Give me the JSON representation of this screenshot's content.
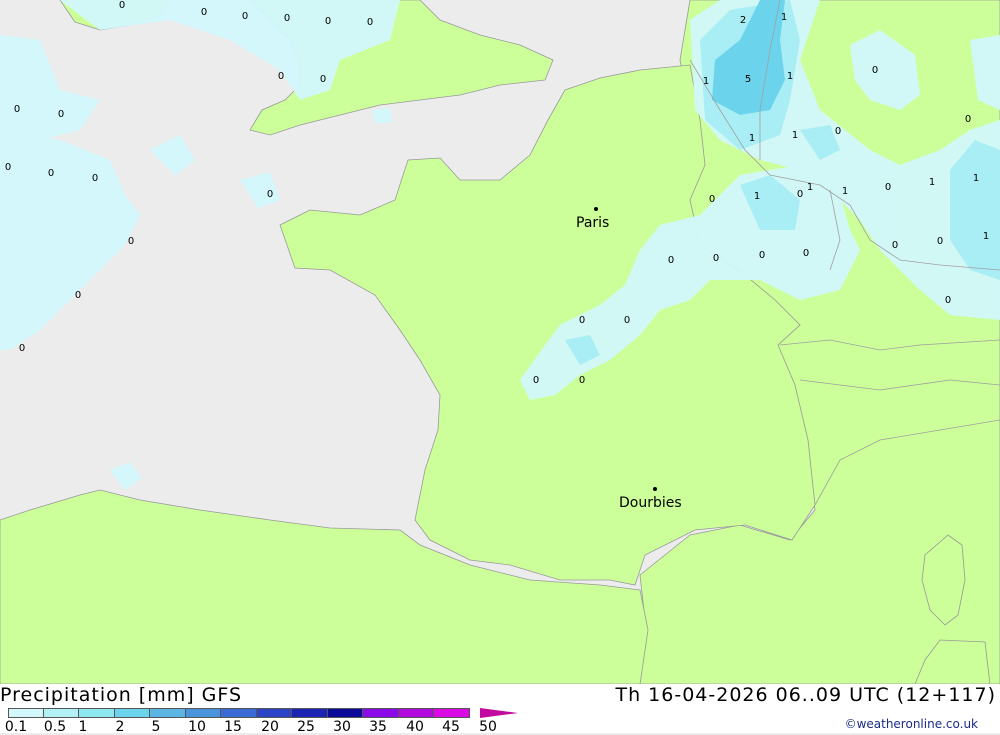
{
  "title": "Precipitation [mm] GFS",
  "valid_time": "Th 16-04-2026 06..09 UTC (12+117)",
  "credit": "©weatheronline.co.uk",
  "legend": {
    "ticks": [
      "0.1",
      "0.5",
      "1",
      "2",
      "5",
      "10",
      "15",
      "20",
      "25",
      "30",
      "35",
      "40",
      "45",
      "50"
    ],
    "colors": [
      "#d2f8fb",
      "#b2f1f5",
      "#8ee8ef",
      "#6cd3ec",
      "#5bb6e4",
      "#4a94dc",
      "#3a6bd5",
      "#2c45c6",
      "#1d24b3",
      "#0b0b99",
      "#8a0ae8",
      "#b30ade",
      "#d90ae3",
      "#e70ac9",
      "#c20aa0"
    ]
  },
  "map_colors": {
    "sea": "#ececec",
    "land": "#ccff99",
    "precip_light": "#d2f8fb",
    "precip_mid": "#a8eef4",
    "precip_high": "#6cd3ec"
  },
  "cities": [
    {
      "name": "Paris"
    },
    {
      "name": "Dourbies"
    }
  ],
  "value_labels": [
    "0",
    "0",
    "0",
    "0",
    "0",
    "0",
    "0",
    "0",
    "0",
    "0",
    "0",
    "0",
    "0",
    "0",
    "0",
    "0",
    "0",
    "0",
    "0",
    "0",
    "0",
    "0",
    "0",
    "0",
    "0",
    "0",
    "0",
    "0",
    "0",
    "0",
    "0",
    "0",
    "0",
    "0",
    "1",
    "1",
    "1",
    "1",
    "1",
    "1",
    "1",
    "1",
    "1",
    "1",
    "1",
    "2",
    "5"
  ]
}
